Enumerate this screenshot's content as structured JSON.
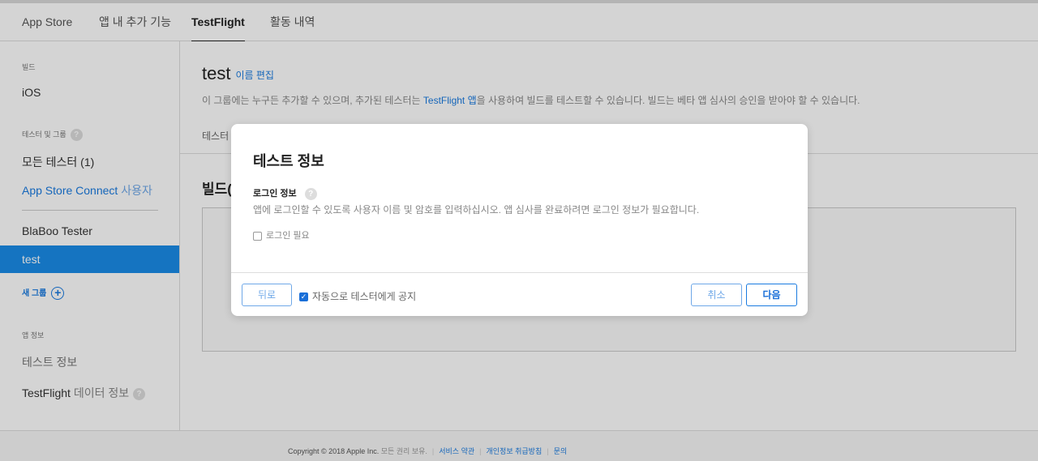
{
  "tabs": [
    {
      "label": "App Store"
    },
    {
      "label": "앱 내 추가 기능"
    },
    {
      "label": "TestFlight"
    },
    {
      "label": "활동 내역"
    }
  ],
  "sidebar": {
    "build_heading": "빌드",
    "ios": "iOS",
    "testers_heading": "테스터 및 그룹",
    "all_testers": "모든 테스터 (1)",
    "asc_users_1": "App Store Connect",
    "asc_users_2": "사용자",
    "group_blaboo": "BlaBoo Tester",
    "group_test": "test",
    "new_group": "새 그룹",
    "app_info_heading": "앱 정보",
    "test_info": "테스트 정보",
    "data_info_1": "TestFlight",
    "data_info_2": "데이터 정보"
  },
  "main": {
    "title": "test",
    "edit_name": "이름 편집",
    "desc_1": "이 그룹에는 누구든 추가할 수 있으며, 추가된 테스터는",
    "desc_link": "TestFlight 앱",
    "desc_2": "을 사용하여 빌드를 테스트할 수 있습니다. 빌드는 베타 앱 심사의 승인을 받아야 할 수 있습니다.",
    "testers_tab": "테스터",
    "builds_heading": "빌드("
  },
  "footer": {
    "copyright": "Copyright © 2018 Apple Inc.",
    "rights": "모든 권리 보유.",
    "terms": "서비스 약관",
    "privacy": "개인정보 취급방침",
    "contact": "문의"
  },
  "modal": {
    "title": "테스트 정보",
    "login_label": "로그인 정보",
    "login_desc": "앱에 로그인할 수 있도록 사용자 이름 및 암호를 입력하십시오. 앱 심사를 완료하려면 로그인 정보가 필요합니다.",
    "login_required": "로그인 필요",
    "back": "뒤로",
    "notify": "자동으로 테스터에게 공지",
    "cancel": "취소",
    "next": "다음"
  },
  "colors": {
    "accent": "#1a7be0",
    "active_sidebar": "#1a8ce8"
  }
}
